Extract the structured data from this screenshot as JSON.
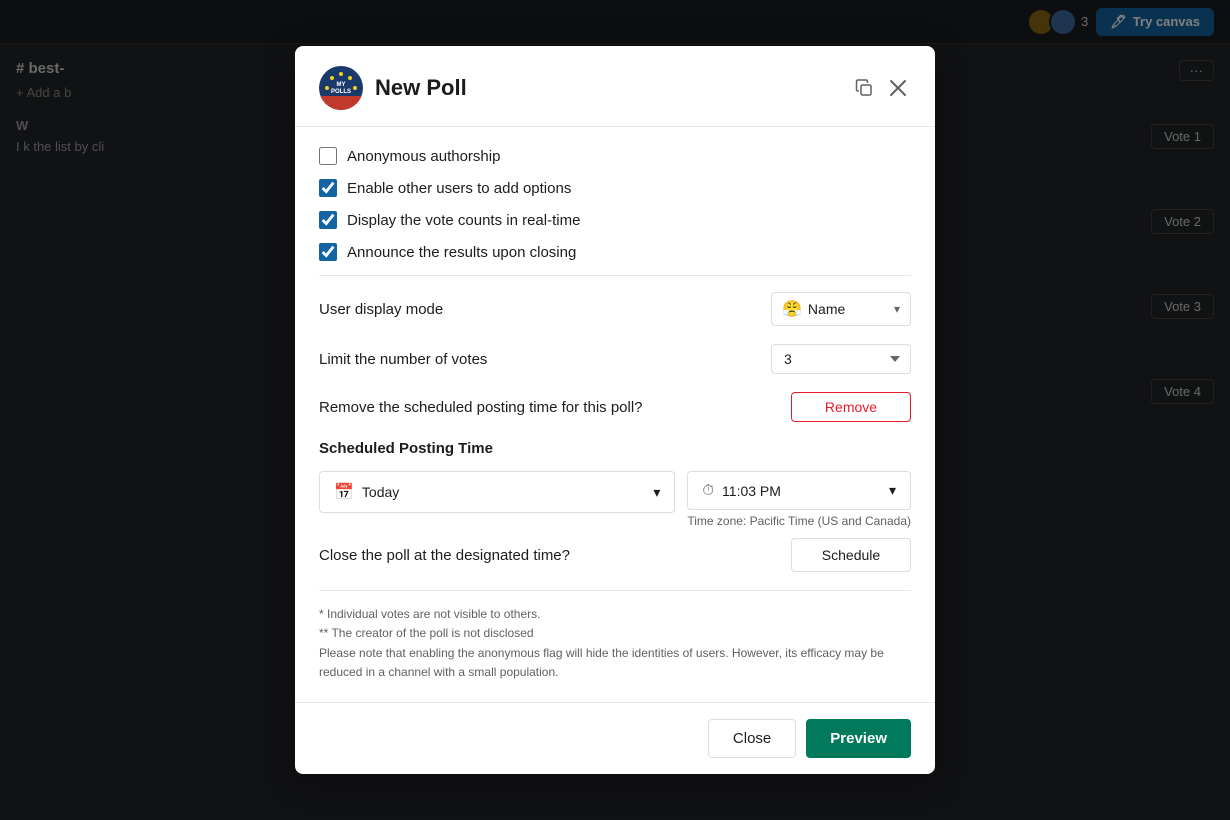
{
  "topbar": {
    "count": "3",
    "try_canvas_label": "Try canvas"
  },
  "channel": {
    "name": "# best-",
    "add_bookmark": "+ Add a b",
    "message_preview": "W",
    "body_text": "I k the list by cli"
  },
  "vote_buttons": [
    {
      "label": "Vote 1"
    },
    {
      "label": "Vote 2"
    },
    {
      "label": "Vote 3"
    },
    {
      "label": "Vote 4"
    }
  ],
  "modal": {
    "title": "New Poll",
    "checkboxes": [
      {
        "id": "anon",
        "label": "Anonymous authorship",
        "checked": false
      },
      {
        "id": "enable_options",
        "label": "Enable other users to add options",
        "checked": true
      },
      {
        "id": "display_votes",
        "label": "Display the vote counts in real-time",
        "checked": true
      },
      {
        "id": "announce",
        "label": "Announce the results upon closing",
        "checked": true
      }
    ],
    "user_display_mode": {
      "label": "User display mode",
      "value": "Name",
      "emoji": "😤"
    },
    "limit_votes": {
      "label": "Limit the number of votes",
      "value": "3"
    },
    "remove_scheduled": {
      "label": "Remove the scheduled posting time for this poll?",
      "button_label": "Remove"
    },
    "scheduled_posting": {
      "section_title": "Scheduled Posting Time",
      "date_label": "Today",
      "time_label": "11:03 PM",
      "timezone": "Time zone: Pacific Time (US and Canada)"
    },
    "close_poll": {
      "label": "Close the poll at the designated time?",
      "button_label": "Schedule"
    },
    "footer_notes": [
      "* Individual votes are not visible to others.",
      "** The creator of the poll is not disclosed",
      "Please note that enabling the anonymous flag will hide the identities of users. However, its efficacy may be reduced in a channel with a small population."
    ],
    "close_button_label": "Close",
    "preview_button_label": "Preview"
  }
}
